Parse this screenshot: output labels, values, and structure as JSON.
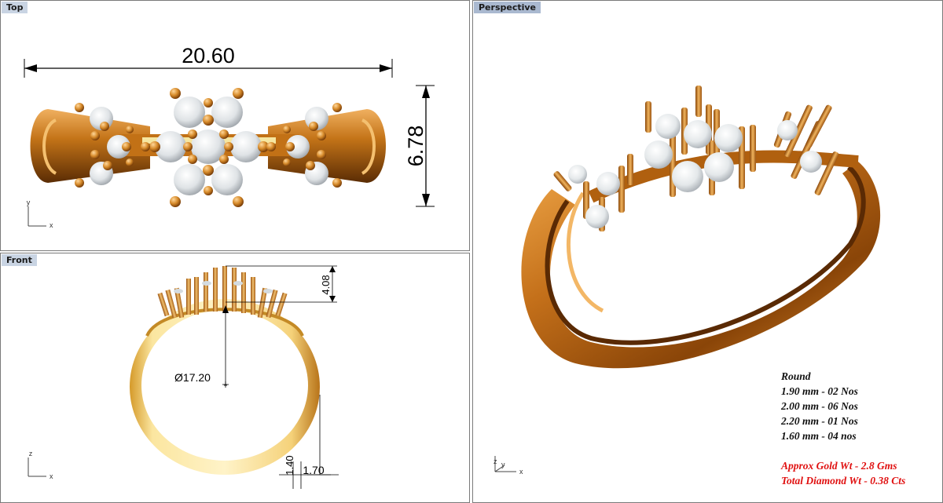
{
  "viewports": {
    "top": {
      "label": "Top",
      "axis_y": "y",
      "axis_x": "x",
      "dim_width": "20.60",
      "dim_height": "6.78"
    },
    "front": {
      "label": "Front",
      "axis_y": "z",
      "axis_x": "x",
      "dim_height": "4.08",
      "dim_diameter": "Ø17.20",
      "dim_thickness": "1.70",
      "dim_band": "1.40"
    },
    "perspective": {
      "label": "Perspective",
      "axis_z": "z",
      "axis_y": "y",
      "axis_x": "x"
    }
  },
  "specs": {
    "heading": "Round",
    "lines": [
      "1.90 mm - 02 Nos",
      "2.00 mm - 06 Nos",
      "2.20 mm - 01 Nos",
      "1.60 mm - 04 nos"
    ],
    "gold_weight": "Approx Gold Wt - 2.8 Gms",
    "diamond_weight": "Total Diamond Wt - 0.38 Cts"
  },
  "colors": {
    "gold": "#c9781a",
    "gold_dark": "#6e3806",
    "gold_light": "#f1b45a",
    "stone": "#e8ecef",
    "tab": "#c9d4e3",
    "note_red": "#e01010"
  }
}
